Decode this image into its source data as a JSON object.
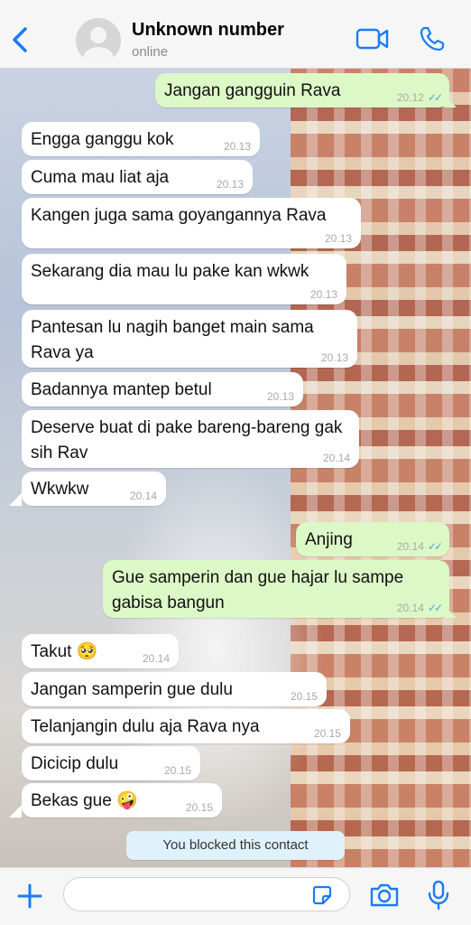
{
  "header": {
    "contact_name": "Unknown number",
    "status": "online",
    "icons": [
      "back-chevron-icon",
      "avatar-placeholder-icon",
      "video-call-icon",
      "voice-call-icon"
    ],
    "accent_color": "#1a7cf5"
  },
  "messages": [
    {
      "dir": "out",
      "text": "Jangan gangguin Rava",
      "time": "20.12",
      "read": "✓✓"
    },
    {
      "dir": "in",
      "text": "Engga ganggu kok",
      "time": "20.13"
    },
    {
      "dir": "in",
      "text": "Cuma mau liat aja",
      "time": "20.13"
    },
    {
      "dir": "in",
      "text": "Kangen juga sama goyangannya Rava",
      "time": "20.13"
    },
    {
      "dir": "in",
      "text": "Sekarang dia mau lu pake kan wkwk",
      "time": "20.13"
    },
    {
      "dir": "in",
      "text": "Pantesan lu nagih banget main sama Rava ya",
      "time": "20.13"
    },
    {
      "dir": "in",
      "text": "Badannya mantep betul",
      "time": "20.13"
    },
    {
      "dir": "in",
      "text": "Deserve buat di pake bareng-bareng gak sih Rav",
      "time": "20.14"
    },
    {
      "dir": "in",
      "text": "Wkwkw",
      "time": "20.14"
    },
    {
      "dir": "out",
      "text": "Anjing",
      "time": "20.14",
      "read": "✓✓"
    },
    {
      "dir": "out",
      "text": "Gue samperin dan gue hajar lu sampe gabisa bangun",
      "time": "20.14",
      "read": "✓✓"
    },
    {
      "dir": "in",
      "text": "Takut 🥺",
      "time": "20.14"
    },
    {
      "dir": "in",
      "text": "Jangan samperin gue dulu",
      "time": "20.15"
    },
    {
      "dir": "in",
      "text": "Telanjangin dulu aja Rava nya",
      "time": "20.15"
    },
    {
      "dir": "in",
      "text": "Dicicip dulu",
      "time": "20.15"
    },
    {
      "dir": "in",
      "text": "Bekas gue 🤪",
      "time": "20.15"
    }
  ],
  "system_notice": "You blocked this contact",
  "input_bar": {
    "placeholder": "",
    "icons": [
      "plus-icon",
      "sticker-icon",
      "camera-icon",
      "microphone-icon"
    ]
  },
  "colors": {
    "incoming_bubble": "#ffffff",
    "outgoing_bubble": "#dcf8c6",
    "read_receipt": "#4fa8e0",
    "system_notice_bg": "#dff1fb"
  }
}
